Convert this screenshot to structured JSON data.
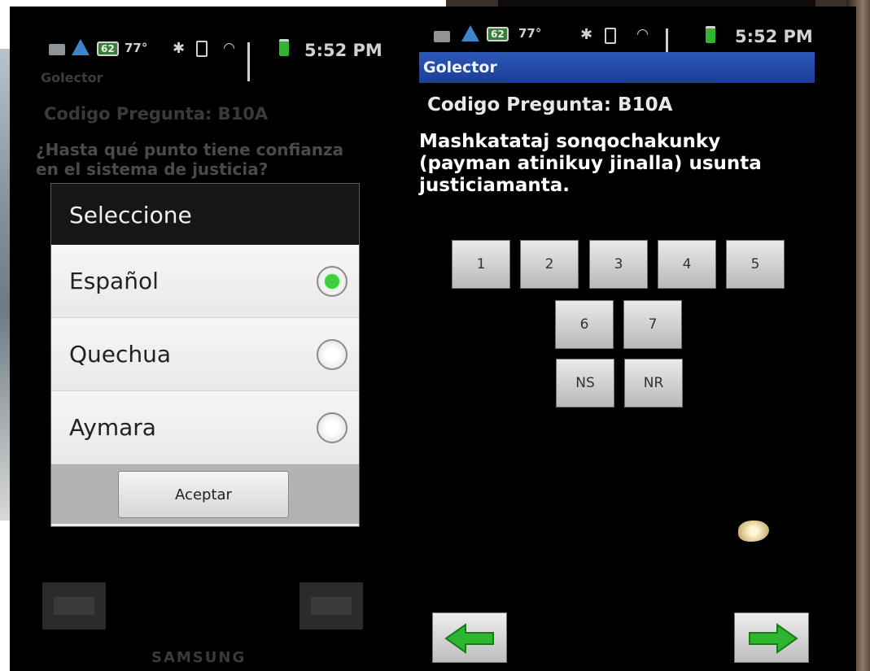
{
  "status_bar": {
    "badge": "62",
    "temperature": "77°",
    "time": "5:52 PM"
  },
  "left_screen": {
    "app_name": "Golector",
    "question_code": "Codigo Pregunta: B10A",
    "question_text": "¿Hasta qué punto tiene confianza en el sistema de justicia?",
    "dialog": {
      "title": "Seleccione",
      "options": [
        {
          "label": "Español",
          "selected": true
        },
        {
          "label": "Quechua",
          "selected": false
        },
        {
          "label": "Aymara",
          "selected": false
        }
      ],
      "accept_label": "Aceptar"
    },
    "brand": "SAMSUNG"
  },
  "right_screen": {
    "app_name": "Golector",
    "question_code": "Codigo Pregunta: B10A",
    "question_text": "Mashkatataj sonqochakunky (payman atinikuy jinalla) usunta justiciamanta.",
    "answers_row1": [
      "1",
      "2",
      "3",
      "4",
      "5"
    ],
    "answers_row2": [
      "6",
      "7"
    ],
    "answers_row3": [
      "NS",
      "NR"
    ]
  },
  "icons": {
    "back": "arrow-left-icon",
    "next": "arrow-right-icon",
    "arrow_color": "#2fb52f"
  },
  "colors": {
    "app_bar": "#1f46a3",
    "radio_selected": "#3fcf3f",
    "battery": "#31b52f"
  }
}
